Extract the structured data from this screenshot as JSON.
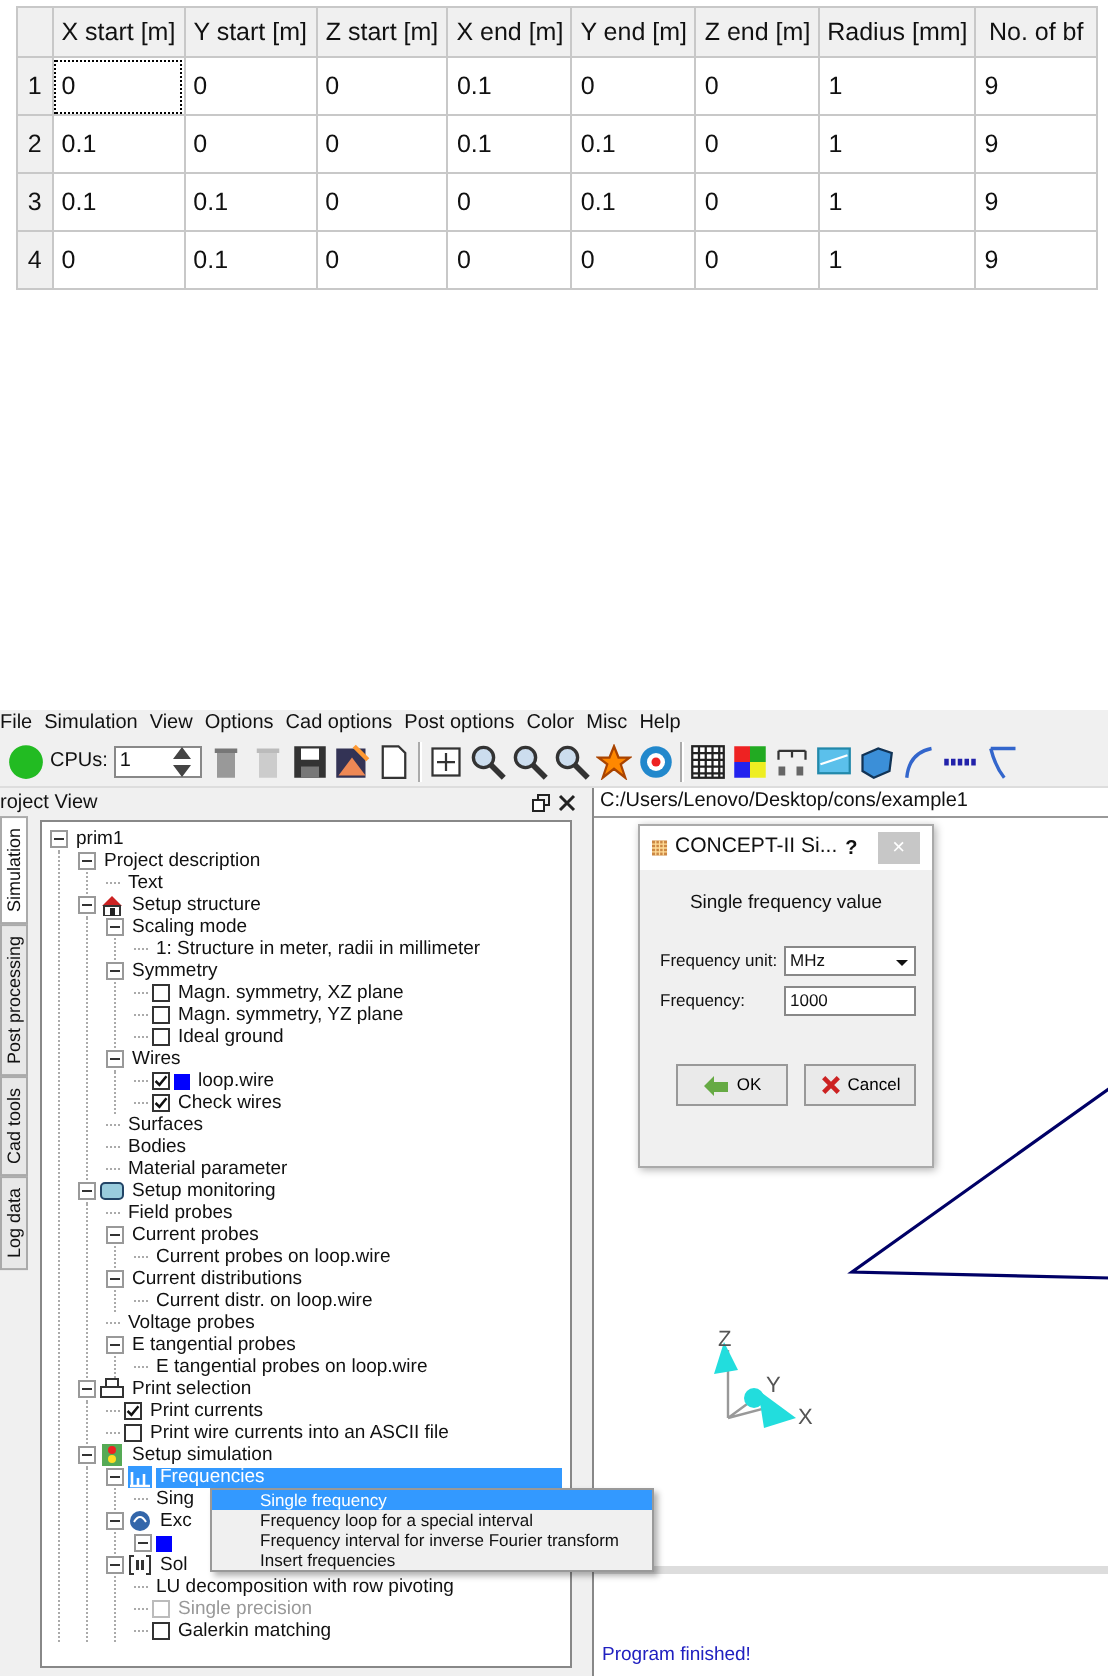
{
  "table": {
    "columns": [
      "X start [m]",
      "Y start [m]",
      "Z start [m]",
      "X end [m]",
      "Y end [m]",
      "Z end [m]",
      "Radius [mm]",
      "No. of bf"
    ],
    "rows": [
      {
        "header": "1",
        "cells": [
          {
            "text": "0",
            "focused": true
          },
          {
            "text": "0",
            "focused": false
          },
          {
            "text": "0",
            "focused": false
          },
          {
            "text": "0.1",
            "focused": false
          },
          {
            "text": "0",
            "focused": false
          },
          {
            "text": "0",
            "focused": false
          },
          {
            "text": "1",
            "focused": false
          },
          {
            "text": "9",
            "focused": false
          }
        ]
      },
      {
        "header": "2",
        "cells": [
          {
            "text": "0.1",
            "focused": false
          },
          {
            "text": "0",
            "focused": false
          },
          {
            "text": "0",
            "focused": false
          },
          {
            "text": "0.1",
            "focused": false
          },
          {
            "text": "0.1",
            "focused": false
          },
          {
            "text": "0",
            "focused": false
          },
          {
            "text": "1",
            "focused": false
          },
          {
            "text": "9",
            "focused": false
          }
        ]
      },
      {
        "header": "3",
        "cells": [
          {
            "text": "0.1",
            "focused": false
          },
          {
            "text": "0.1",
            "focused": false
          },
          {
            "text": "0",
            "focused": false
          },
          {
            "text": "0",
            "focused": false
          },
          {
            "text": "0.1",
            "focused": false
          },
          {
            "text": "0",
            "focused": false
          },
          {
            "text": "1",
            "focused": false
          },
          {
            "text": "9",
            "focused": false
          }
        ]
      },
      {
        "header": "4",
        "cells": [
          {
            "text": "0",
            "focused": false
          },
          {
            "text": "0.1",
            "focused": false
          },
          {
            "text": "0",
            "focused": false
          },
          {
            "text": "0",
            "focused": false
          },
          {
            "text": "0",
            "focused": false
          },
          {
            "text": "0",
            "focused": false
          },
          {
            "text": "1",
            "focused": false
          },
          {
            "text": "9",
            "focused": false
          }
        ]
      }
    ]
  },
  "app": {
    "menubar": [
      "File",
      "Simulation",
      "View",
      "Options",
      "Cad options",
      "Post options",
      "Color",
      "Misc",
      "Help"
    ],
    "toolbar": {
      "cpus_label": "CPUs:",
      "cpus_value": "1"
    },
    "project_view": {
      "title": "roject View",
      "side_tabs": [
        {
          "label": "Simulation",
          "selected": true
        },
        {
          "label": "Post processing",
          "selected": false
        },
        {
          "label": "Cad tools",
          "selected": false
        },
        {
          "label": "Log data",
          "selected": false
        }
      ],
      "tree": [
        {
          "label": "prim1",
          "expanded": true,
          "children": [
            {
              "label": "Project description",
              "expanded": true,
              "children": [
                {
                  "label": "Text"
                }
              ]
            },
            {
              "label": "Setup structure",
              "kind": "structure",
              "expanded": true,
              "children": [
                {
                  "label": "Scaling mode",
                  "expanded": true,
                  "children": [
                    {
                      "label": "1: Structure in meter, radii in millimeter"
                    }
                  ]
                },
                {
                  "label": "Symmetry",
                  "expanded": true,
                  "children": [
                    {
                      "label": "Magn. symmetry, XZ plane",
                      "checked": false
                    },
                    {
                      "label": "Magn. symmetry, YZ plane",
                      "checked": false
                    },
                    {
                      "label": "Ideal ground",
                      "checked": false
                    }
                  ]
                },
                {
                  "label": "Wires",
                  "expanded": true,
                  "children": [
                    {
                      "label": "loop.wire",
                      "checked": true,
                      "color": "#0000ff"
                    },
                    {
                      "label": "Check wires",
                      "checked": true
                    }
                  ]
                },
                {
                  "label": "Surfaces"
                },
                {
                  "label": "Bodies"
                },
                {
                  "label": "Material parameter"
                }
              ]
            },
            {
              "label": "Setup monitoring",
              "kind": "monitoring",
              "expanded": true,
              "children": [
                {
                  "label": "Field probes"
                },
                {
                  "label": "Current probes",
                  "expanded": true,
                  "children": [
                    {
                      "label": "Current probes on loop.wire"
                    }
                  ]
                },
                {
                  "label": "Current distributions",
                  "expanded": true,
                  "children": [
                    {
                      "label": "Current distr. on loop.wire"
                    }
                  ]
                },
                {
                  "label": "Voltage probes"
                },
                {
                  "label": "E tangential probes",
                  "expanded": true,
                  "children": [
                    {
                      "label": "E tangential probes on loop.wire"
                    }
                  ]
                }
              ]
            },
            {
              "label": "Print selection",
              "kind": "print",
              "expanded": true,
              "children": [
                {
                  "label": "Print currents",
                  "checked": true
                },
                {
                  "label": "Print wire currents into an ASCII file",
                  "checked": false
                }
              ]
            },
            {
              "label": "Setup simulation",
              "kind": "simulation",
              "expanded": true,
              "children": [
                {
                  "label": "Frequencies",
                  "kind": "frequencies",
                  "expanded": true,
                  "selected": true,
                  "children": [
                    {
                      "label": "Sing"
                    }
                  ]
                },
                {
                  "label": "Exc",
                  "kind": "excitation",
                  "expanded": true,
                  "children": [
                    {
                      "color": "#0000ff",
                      "expanded": true
                    }
                  ]
                },
                {
                  "label": "Sol",
                  "kind": "solver",
                  "expanded": true,
                  "children": [
                    {
                      "label": "LU decomposition with row pivoting"
                    },
                    {
                      "label": "Single precision",
                      "checked": false,
                      "disabled": true
                    },
                    {
                      "label": "Galerkin matching",
                      "checked": false
                    }
                  ]
                }
              ]
            }
          ]
        }
      ],
      "context_menu": [
        {
          "label": "Single frequency",
          "selected": true
        },
        {
          "label": "Frequency loop for a special interval",
          "selected": false
        },
        {
          "label": "Frequency interval for inverse Fourier transform",
          "selected": false
        },
        {
          "label": "Insert frequencies",
          "selected": false
        }
      ]
    },
    "viewer": {
      "path": "C:/Users/Lenovo/Desktop/cons/example1",
      "axis_labels": {
        "x": "X",
        "y": "Y",
        "z": "Z"
      }
    },
    "dialog": {
      "title": "CONCEPT-II Si...",
      "help": "?",
      "close": "×",
      "heading": "Single frequency value",
      "fields": [
        {
          "label": "Frequency unit:",
          "kind": "select",
          "value": "MHz"
        },
        {
          "label": "Frequency:",
          "kind": "text",
          "value": "1000"
        }
      ],
      "buttons": [
        {
          "label": "OK",
          "kind": "ok"
        },
        {
          "label": "Cancel",
          "kind": "cancel"
        }
      ]
    },
    "output": {
      "lines": [
        "Program finished!"
      ]
    }
  }
}
